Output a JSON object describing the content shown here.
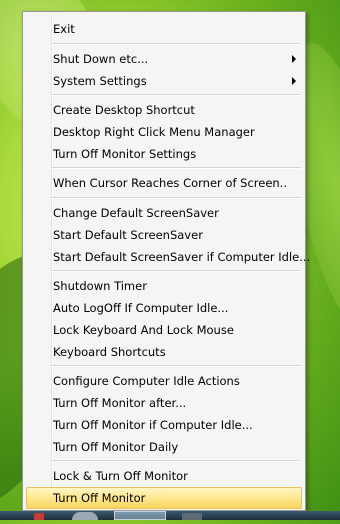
{
  "menu": {
    "items": [
      {
        "label": "Exit"
      },
      {
        "label": "Shut Down etc..."
      },
      {
        "label": "System Settings"
      },
      {
        "label": "Create Desktop Shortcut"
      },
      {
        "label": "Desktop Right Click Menu Manager"
      },
      {
        "label": "Turn Off Monitor Settings"
      },
      {
        "label": "When Cursor Reaches Corner of Screen.."
      },
      {
        "label": "Change Default ScreenSaver"
      },
      {
        "label": "Start Default ScreenSaver"
      },
      {
        "label": "Start Default ScreenSaver if Computer Idle..."
      },
      {
        "label": "Shutdown Timer"
      },
      {
        "label": "Auto LogOff If Computer Idle..."
      },
      {
        "label": "Lock Keyboard And Lock Mouse"
      },
      {
        "label": "Keyboard Shortcuts"
      },
      {
        "label": "Configure Computer Idle Actions"
      },
      {
        "label": "Turn Off Monitor after..."
      },
      {
        "label": "Turn Off Monitor if Computer Idle..."
      },
      {
        "label": "Turn Off Monitor Daily"
      },
      {
        "label": "Lock & Turn Off Monitor"
      },
      {
        "label": "Turn Off Monitor"
      }
    ],
    "highlighted_item": "Turn Off Monitor"
  },
  "colors": {
    "menu_background": "#f5f5f5",
    "highlight": "#fde68a"
  }
}
